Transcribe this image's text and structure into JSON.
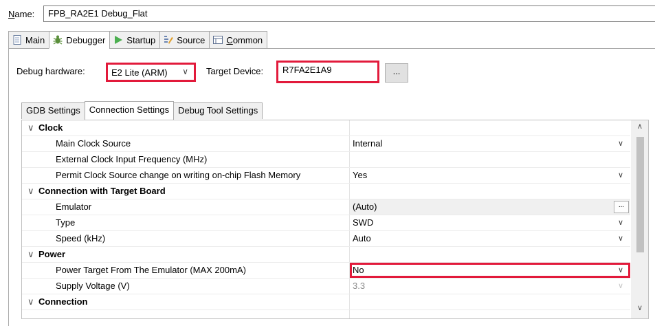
{
  "name_row": {
    "label_prefix": "N",
    "label_rest": "ame:",
    "value": "FPB_RA2E1 Debug_Flat"
  },
  "top_tabs": [
    {
      "label_pre": "Main",
      "label_u": "",
      "label_post": ""
    },
    {
      "label_pre": "Debugger",
      "label_u": "",
      "label_post": ""
    },
    {
      "label_pre": "Startup",
      "label_u": "",
      "label_post": ""
    },
    {
      "label_pre": "Source",
      "label_u": "",
      "label_post": ""
    },
    {
      "label_pre": "",
      "label_u": "C",
      "label_post": "ommon"
    }
  ],
  "debug_hardware": {
    "label": "Debug hardware:",
    "value": "E2 Lite (ARM)",
    "chevron": "∨"
  },
  "target_device": {
    "label": "Target Device:",
    "value": "R7FA2E1A9",
    "browse_label": "..."
  },
  "sub_tabs": [
    "GDB Settings",
    "Connection Settings",
    "Debug Tool Settings"
  ],
  "properties": {
    "clock": {
      "title": "Clock",
      "main_clock_source": {
        "label": "Main Clock Source",
        "value": "Internal"
      },
      "ext_clock_freq": {
        "label": "External Clock Input Frequency (MHz)",
        "value": ""
      },
      "permit_clock_change": {
        "label": "Permit Clock Source change on writing on-chip Flash Memory",
        "value": "Yes"
      }
    },
    "connection_with_target": {
      "title": "Connection with Target Board",
      "emulator": {
        "label": "Emulator",
        "value": "(Auto)",
        "browse_label": "..."
      },
      "type": {
        "label": "Type",
        "value": "SWD"
      },
      "speed": {
        "label": "Speed (kHz)",
        "value": "Auto"
      }
    },
    "power": {
      "title": "Power",
      "power_target": {
        "label": "Power Target From The Emulator (MAX 200mA)",
        "value": "No"
      },
      "supply_voltage": {
        "label": "Supply Voltage (V)",
        "value": "3.3"
      }
    },
    "connection": {
      "title": "Connection"
    }
  },
  "colors": {
    "highlight": "#e21a3b",
    "tab_bg": "#f0f0f0",
    "border": "#a9a9a9"
  },
  "icons": [
    "main-tab-icon",
    "debugger-bug-icon",
    "startup-play-icon",
    "source-icon",
    "common-icon",
    "collapse-caret-icon",
    "dropdown-chevron-icon",
    "scroll-up-icon",
    "scroll-down-icon"
  ]
}
